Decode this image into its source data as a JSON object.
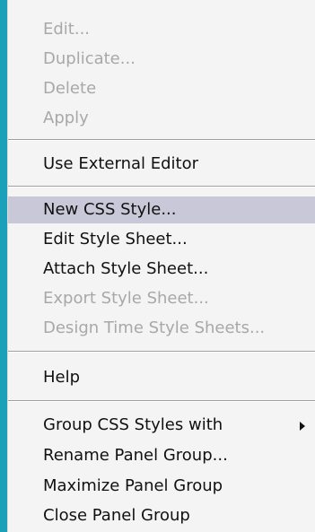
{
  "menu": {
    "items": [
      {
        "label": "Edit...",
        "enabled": false
      },
      {
        "label": "Duplicate...",
        "enabled": false
      },
      {
        "label": "Delete",
        "enabled": false
      },
      {
        "label": "Apply",
        "enabled": false
      },
      {
        "label": "Use External Editor",
        "enabled": true
      },
      {
        "label": "New CSS Style...",
        "enabled": true,
        "highlighted": true
      },
      {
        "label": "Edit Style Sheet...",
        "enabled": true
      },
      {
        "label": "Attach Style Sheet...",
        "enabled": true
      },
      {
        "label": "Export Style Sheet...",
        "enabled": false
      },
      {
        "label": "Design Time Style Sheets...",
        "enabled": false
      },
      {
        "label": "Help",
        "enabled": true
      },
      {
        "label": "Group CSS Styles with",
        "enabled": true,
        "submenu": true
      },
      {
        "label": "Rename Panel Group...",
        "enabled": true
      },
      {
        "label": "Maximize Panel Group",
        "enabled": true
      },
      {
        "label": "Close Panel Group",
        "enabled": true
      }
    ]
  },
  "icons": {
    "submenu_arrow": "chevron-right-icon"
  },
  "colors": {
    "frame": "#1aa0b8",
    "menu_background": "#f4f4f4",
    "highlight": "#c8c8d8",
    "disabled_text": "#a8a8a8",
    "text": "#111111"
  }
}
